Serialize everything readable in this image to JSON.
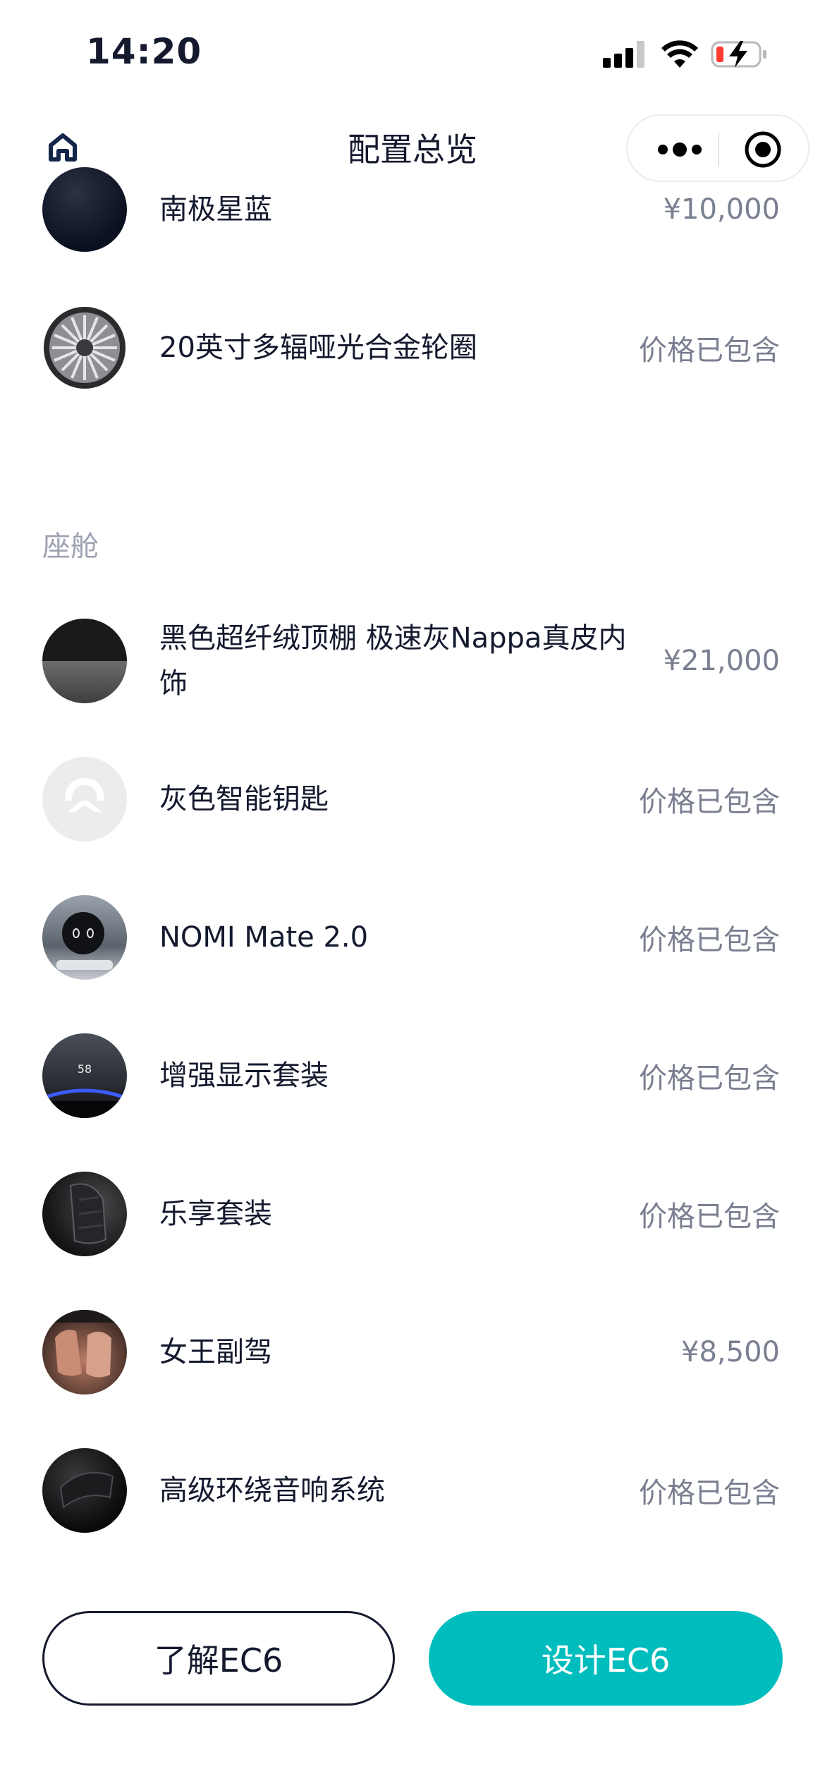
{
  "status_bar": {
    "time": "14:20"
  },
  "nav": {
    "title": "配置总览"
  },
  "items_top": [
    {
      "label": "南极星蓝",
      "price": "¥10,000",
      "thumb": "dark-blue-paint"
    },
    {
      "label": "20英寸多辐哑光合金轮圈",
      "price": "价格已包含",
      "thumb": "wheel"
    }
  ],
  "section": {
    "title": "座舱"
  },
  "items_cabin": [
    {
      "label": "黑色超纤绒顶棚 极速灰Nappa真皮内饰",
      "price": "¥21,000",
      "thumb": "interior-split"
    },
    {
      "label": "灰色智能钥匙",
      "price": "价格已包含",
      "thumb": "grey-key"
    },
    {
      "label": "NOMI Mate 2.0",
      "price": "价格已包含",
      "thumb": "nomi"
    },
    {
      "label": "增强显示套装",
      "price": "价格已包含",
      "thumb": "display",
      "thumb_text": "58"
    },
    {
      "label": "乐享套装",
      "price": "价格已包含",
      "thumb": "seat"
    },
    {
      "label": "女王副驾",
      "price": "¥8,500",
      "thumb": "queen-seat"
    },
    {
      "label": "高级环绕音响系统",
      "price": "价格已包含",
      "thumb": "speaker"
    }
  ],
  "buttons": {
    "learn": "了解EC6",
    "design": "设计EC6"
  },
  "colors": {
    "accent": "#00bdbd",
    "text": "#14192e",
    "muted": "#7a7f91",
    "section": "#9ea2b1"
  }
}
